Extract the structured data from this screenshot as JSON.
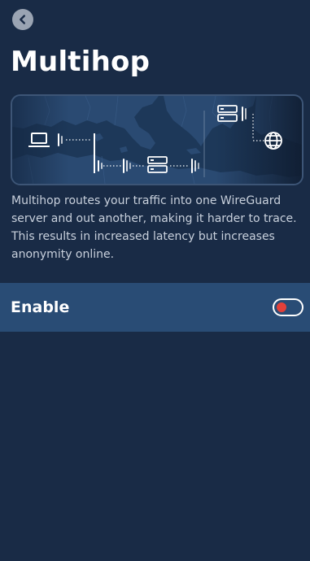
{
  "header": {
    "back_icon": "chevron-left-icon",
    "title": "Multihop"
  },
  "illustration": {
    "icons": [
      "laptop-icon",
      "server-icon",
      "server-icon",
      "globe-icon"
    ]
  },
  "description": "Multihop routes your traffic into one WireGuard server and out another, making it harder to trace. This results in increased latency but increases anonymity online.",
  "enable": {
    "label": "Enable",
    "enabled": false
  },
  "colors": {
    "background": "#192b46",
    "row_background": "#294c75",
    "toggle_knob_off": "#e34039",
    "text_secondary": "#c8d0dc"
  }
}
